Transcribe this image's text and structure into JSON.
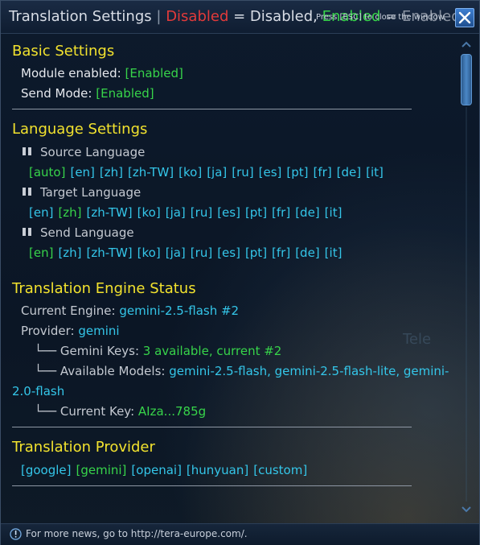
{
  "window": {
    "title": "Translation Settings",
    "title_sep": "|",
    "title_disabled": "Disabled",
    "title_disabled_rest": "= Disabled,",
    "title_enabled": "Enabled",
    "title_enabled_rest": "= Enabled",
    "esc_hint": "Press [ESC] to close the window.",
    "close_icon": "close-icon"
  },
  "basic": {
    "heading": "Basic Settings",
    "module_label": "Module enabled:",
    "module_value": "[Enabled]",
    "send_label": "Send Mode:",
    "send_value": "[Enabled]"
  },
  "language": {
    "heading": "Language Settings",
    "source_label": "Source Language",
    "source_options": [
      "[auto]",
      "[en]",
      "[zh]",
      "[zh-TW]",
      "[ko]",
      "[ja]",
      "[ru]",
      "[es]",
      "[pt]",
      "[fr]",
      "[de]",
      "[it]"
    ],
    "source_selected": "[auto]",
    "target_label": "Target Language",
    "target_options": [
      "[en]",
      "[zh]",
      "[zh-TW]",
      "[ko]",
      "[ja]",
      "[ru]",
      "[es]",
      "[pt]",
      "[fr]",
      "[de]",
      "[it]"
    ],
    "target_selected": "[zh]",
    "send_label": "Send Language",
    "send_options": [
      "[en]",
      "[zh]",
      "[zh-TW]",
      "[ko]",
      "[ja]",
      "[ru]",
      "[es]",
      "[pt]",
      "[fr]",
      "[de]",
      "[it]"
    ],
    "send_selected": "[en]"
  },
  "engine": {
    "heading": "Translation Engine Status",
    "current_label": "Current Engine:",
    "current_value": "gemini-2.5-flash #2",
    "provider_label": "Provider:",
    "provider_value": "gemini",
    "tree_branch": "└──",
    "keys_label": "Gemini Keys:",
    "keys_value": "3 available, current #2",
    "models_label": "Available Models:",
    "models_value": "gemini-2.5-flash, gemini-2.5-flash-lite, gemini-",
    "models_value_cont": "2.0-flash",
    "current_key_label": "Current Key:",
    "current_key_value": "AIza...785g"
  },
  "provider": {
    "heading": "Translation Provider",
    "options": [
      "[google]",
      "[gemini]",
      "[openai]",
      "[hunyuan]",
      "[custom]"
    ],
    "selected": "[gemini]"
  },
  "footer": {
    "text": "For more news, go to http://tera-europe.com/."
  },
  "background_text": "Tele",
  "colors": {
    "heading": "#f2e22e",
    "enabled": "#37d44a",
    "disabled": "#e23a3a",
    "link": "#34c6e9"
  }
}
